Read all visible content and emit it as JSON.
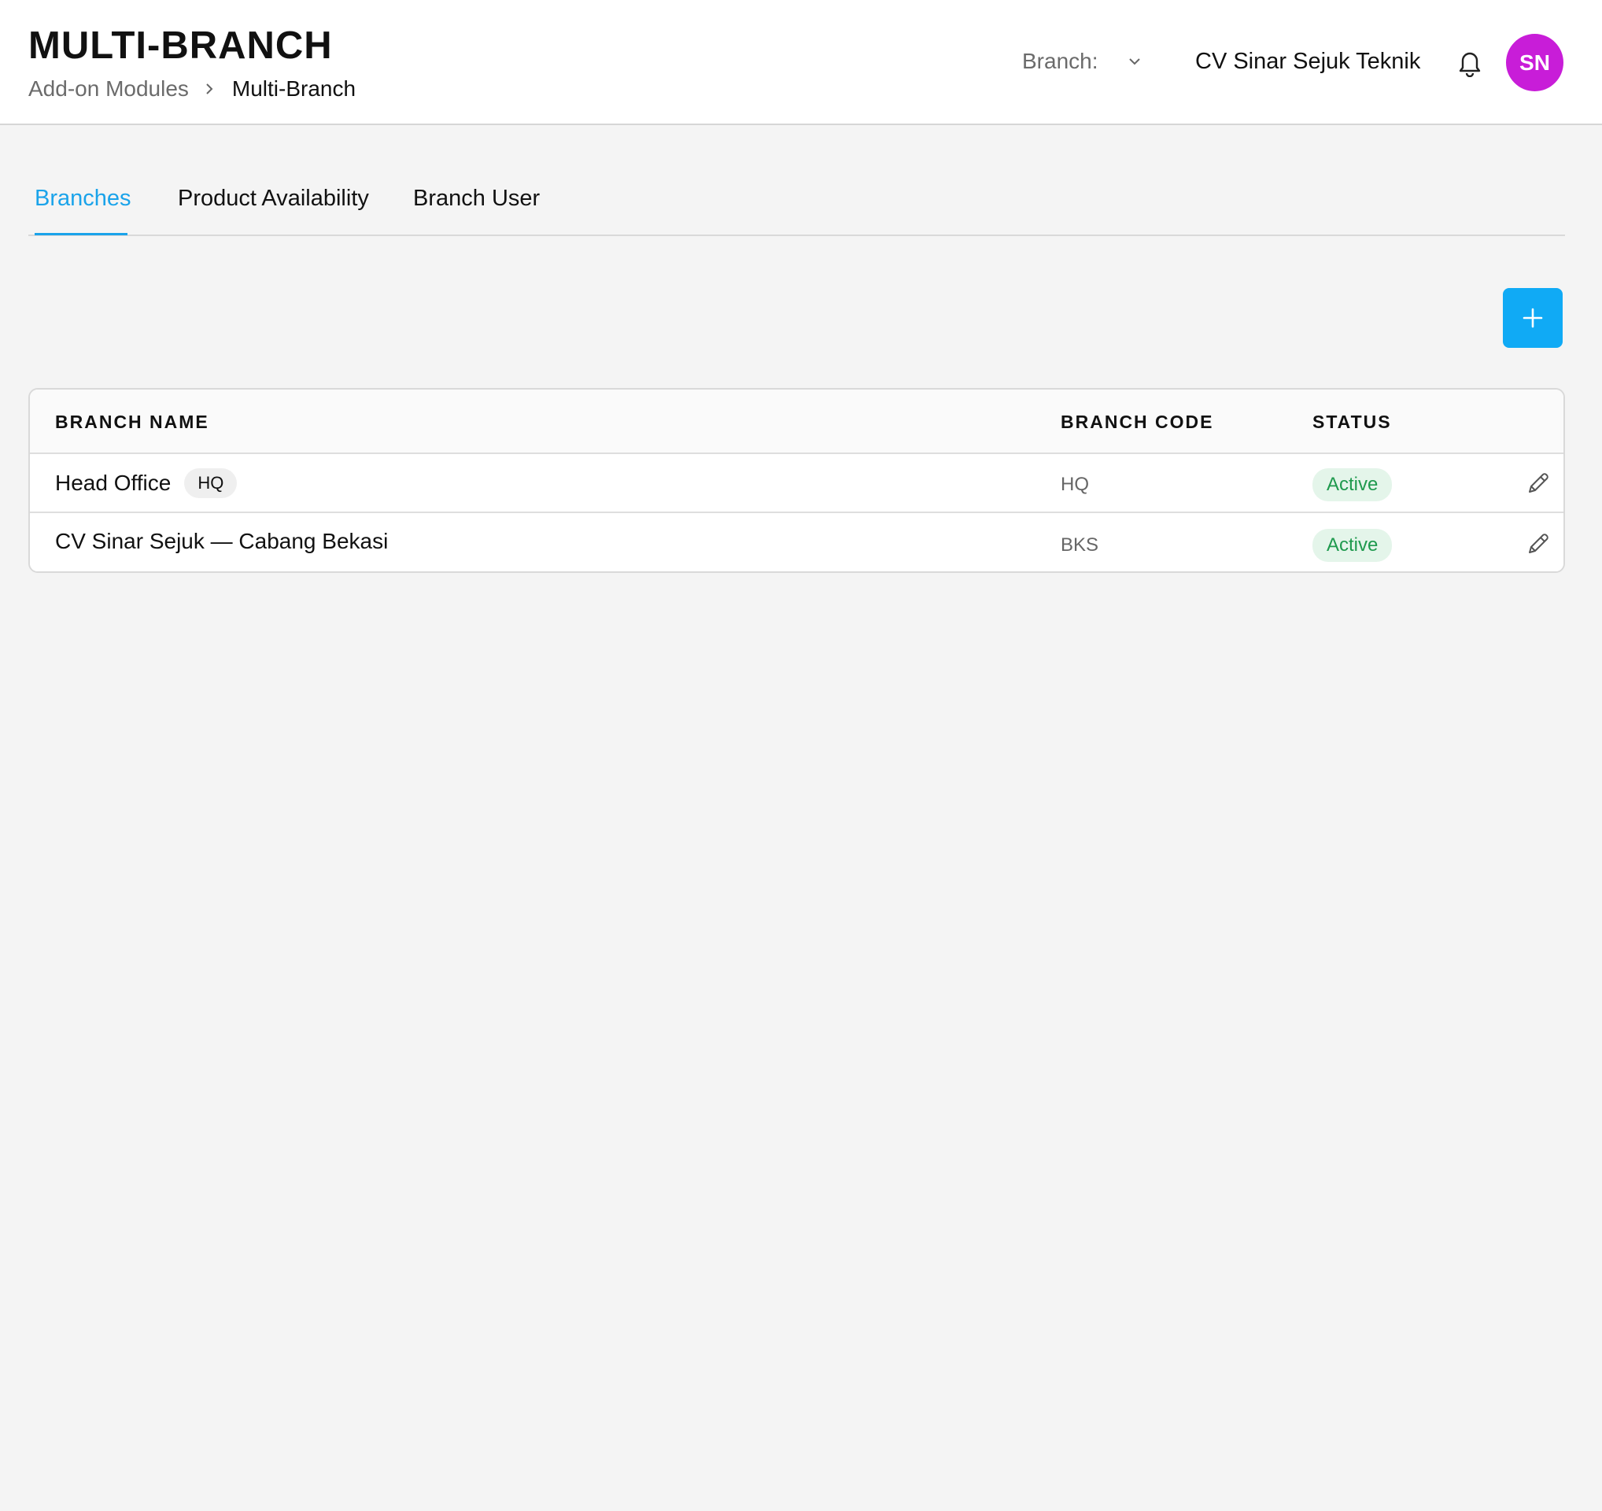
{
  "header": {
    "title": "MULTI-BRANCH",
    "breadcrumb": {
      "parent": "Add-on Modules",
      "current": "Multi-Branch"
    },
    "branch_label": "Branch:",
    "company": "CV Sinar Sejuk Teknik",
    "avatar_initials": "SN",
    "avatar_color": "#c81dd8"
  },
  "tabs": [
    {
      "label": "Branches",
      "active": true
    },
    {
      "label": "Product Availability",
      "active": false
    },
    {
      "label": "Branch User",
      "active": false
    }
  ],
  "accent_color": "#1aa3ea",
  "add_button_icon": "plus-icon",
  "table": {
    "columns": [
      "BRANCH NAME",
      "BRANCH CODE",
      "STATUS"
    ],
    "rows": [
      {
        "name": "Head Office",
        "tag": "HQ",
        "code": "HQ",
        "status": "Active"
      },
      {
        "name": "CV Sinar Sejuk — Cabang Bekasi",
        "code": "BKS",
        "status": "Active"
      }
    ]
  }
}
